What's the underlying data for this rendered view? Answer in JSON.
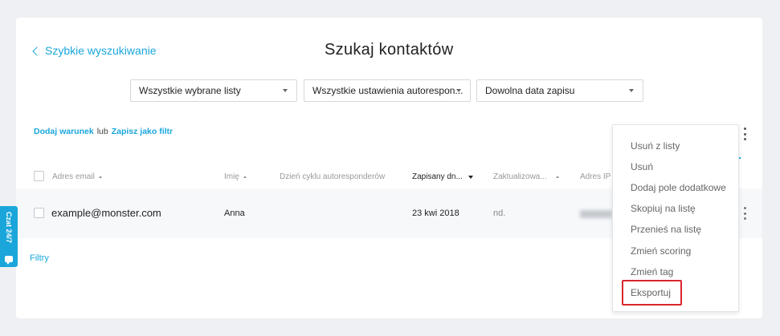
{
  "header": {
    "back_link": "Szybkie wyszukiwanie",
    "title": "Szukaj kontaktów"
  },
  "filters": {
    "lists": "Wszystkie wybrane listy",
    "autoresponder": "Wszystkie ustawienia autorespon...",
    "date": "Dowolna data zapisu"
  },
  "conditions": {
    "add_condition": "Dodaj warunek",
    "or": "lub",
    "save_filter": "Zapisz jako filtr"
  },
  "table": {
    "columns": [
      "Adres email",
      "Imię",
      "Dzień cyklu autoresponderów",
      "Zapisany dn...",
      "Zaktualizowa...",
      "Adres IP"
    ],
    "rows": [
      {
        "email": "example@monster.com",
        "name": "Anna",
        "cycle_day": "",
        "subscribed": "23 kwi 2018",
        "updated": "nd.",
        "ip": ""
      }
    ]
  },
  "filtry_link": "Filtry",
  "side_chat": "Czat 24/7",
  "menu": {
    "items": [
      "Usuń z listy",
      "Usuń",
      "Dodaj pole dodatkowe",
      "Skopiuj na listę",
      "Przenieś na listę",
      "Zmień scoring",
      "Zmień tag",
      "Eksportuj"
    ],
    "highlighted": "Eksportuj"
  },
  "colors": {
    "accent": "#1aa6db",
    "highlight": "#d9262c",
    "background": "#eef0f3"
  }
}
